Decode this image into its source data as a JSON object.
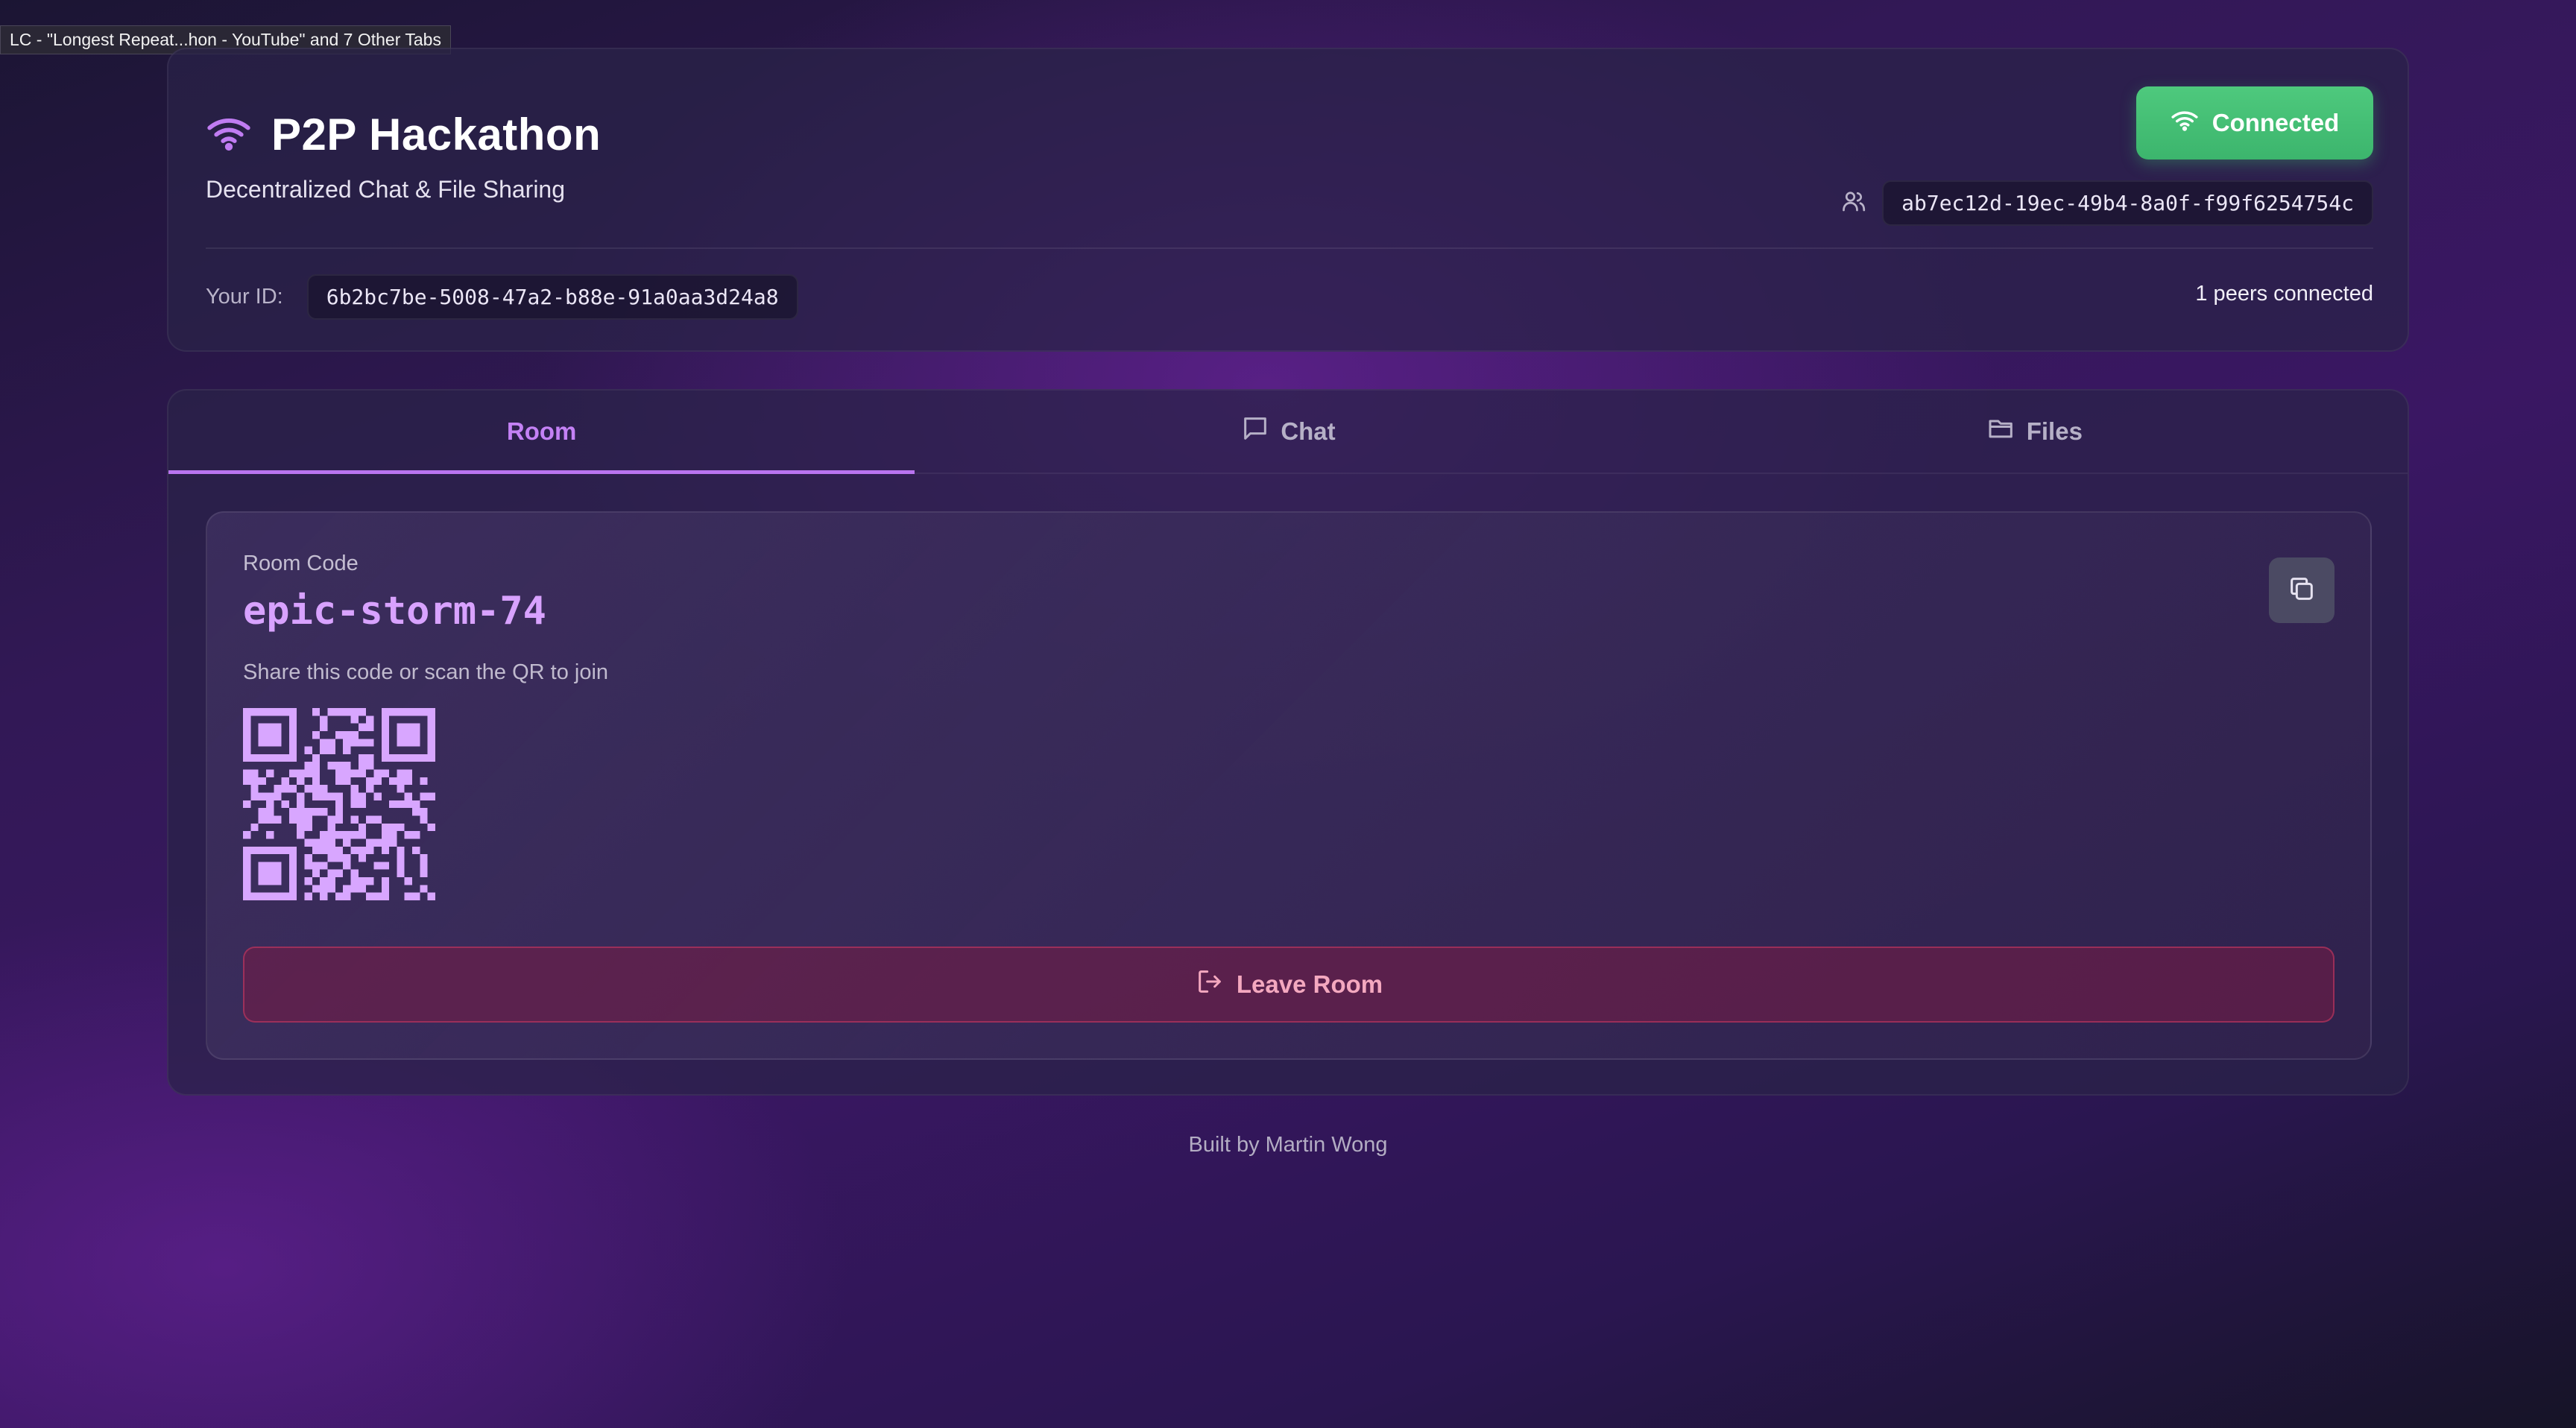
{
  "browser": {
    "tab_tooltip": "LC - \"Longest Repeat...hon - YouTube\" and 7 Other Tabs"
  },
  "header": {
    "title": "P2P Hackathon",
    "subtitle": "Decentralized Chat & File Sharing",
    "status_label": "Connected",
    "peer_id": "ab7ec12d-19ec-49b4-8a0f-f99f6254754c",
    "your_id_label": "Your ID:",
    "your_id": "6b2bc7be-5008-47a2-b88e-91a0aa3d24a8",
    "peers_text": "1 peers connected"
  },
  "tabs": [
    {
      "label": "Room",
      "icon": "none",
      "active": true
    },
    {
      "label": "Chat",
      "icon": "chat-bubble-icon",
      "active": false
    },
    {
      "label": "Files",
      "icon": "folder-icon",
      "active": false
    }
  ],
  "room": {
    "code_label": "Room Code",
    "code": "epic-storm-74",
    "share_text": "Share this code or scan the QR to join",
    "leave_label": "Leave Room"
  },
  "footer": {
    "text": "Built by Martin Wong"
  },
  "colors": {
    "accent": "#c481f5",
    "connected": "#45c176",
    "danger": "#f4a8bf",
    "qr": "#d8a6ff"
  }
}
